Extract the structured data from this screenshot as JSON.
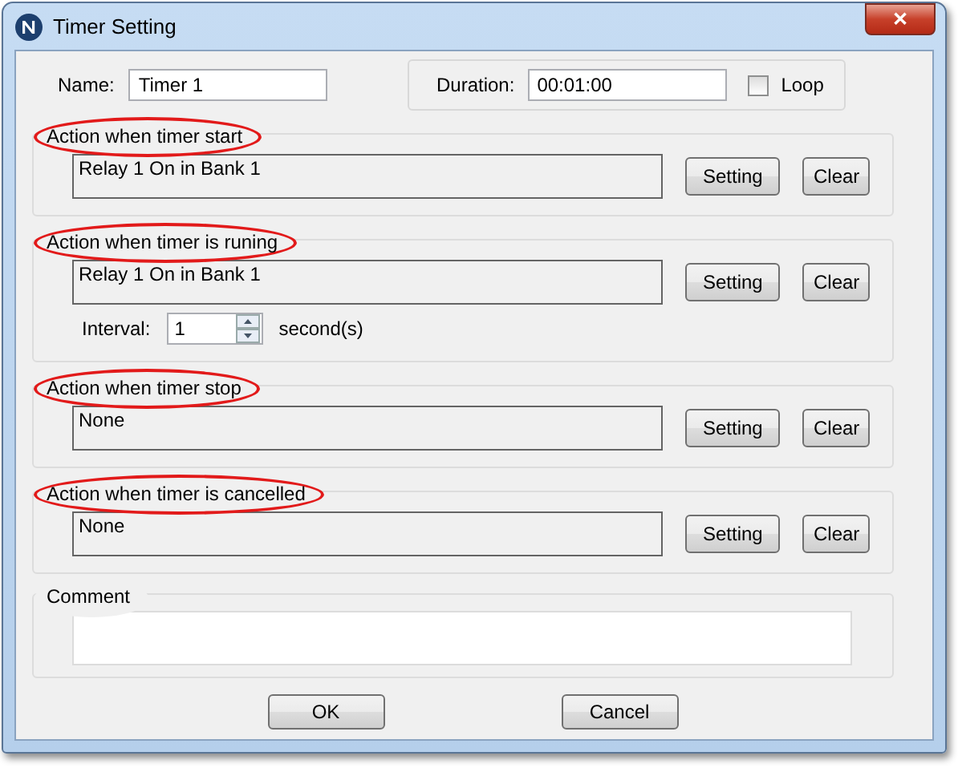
{
  "window": {
    "title": "Timer Setting",
    "close": "✕"
  },
  "name": {
    "label": "Name:",
    "value": "Timer 1"
  },
  "duration": {
    "label": "Duration:",
    "value": "00:01:00"
  },
  "loop": {
    "label": "Loop",
    "checked": false
  },
  "sections": [
    {
      "kind": "action",
      "title": "Action when timer start",
      "value": "Relay 1 On in Bank 1",
      "buttons": [
        "Setting",
        "Clear"
      ]
    },
    {
      "kind": "interval",
      "title": "Action when timer is runing",
      "value": "Relay 1 On in Bank 1",
      "buttons": [
        "Setting",
        "Clear"
      ],
      "interval": {
        "label": "Interval:",
        "value": "1",
        "unit": "second(s)"
      }
    },
    {
      "kind": "action",
      "title": "Action when timer stop",
      "value": "None",
      "buttons": [
        "Setting",
        "Clear"
      ]
    },
    {
      "kind": "action",
      "title": "Action when timer is cancelled",
      "value": "None",
      "buttons": [
        "Setting",
        "Clear"
      ]
    }
  ],
  "comment": {
    "title": "Comment"
  },
  "buttons": [
    "OK",
    "Cancel"
  ]
}
